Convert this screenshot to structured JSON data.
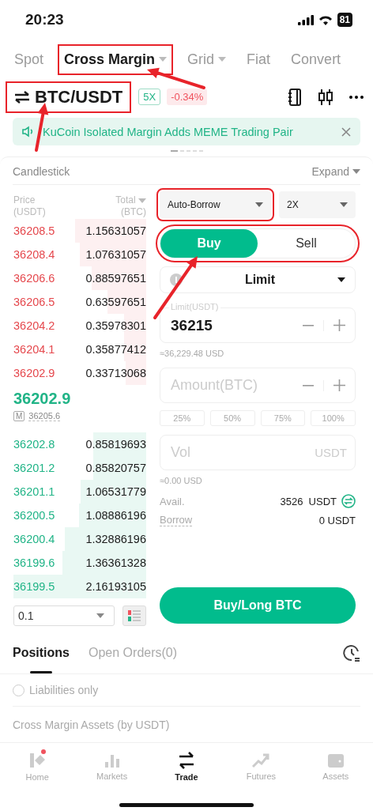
{
  "status_bar": {
    "time": "20:23",
    "battery": "81"
  },
  "market_tabs": [
    {
      "label": "Spot",
      "selected": false,
      "dropdown": false,
      "highlighted": false
    },
    {
      "label": "Cross Margin",
      "selected": true,
      "dropdown": true,
      "highlighted": true
    },
    {
      "label": "Grid",
      "selected": false,
      "dropdown": true,
      "highlighted": false
    },
    {
      "label": "Fiat",
      "selected": false,
      "dropdown": false,
      "highlighted": false
    },
    {
      "label": "Convert",
      "selected": false,
      "dropdown": false,
      "highlighted": false
    }
  ],
  "annotations": {
    "tab_arrow": true,
    "pair_arrow": true,
    "sides_arrow": true
  },
  "pair": {
    "symbol": "BTC/USDT",
    "highlighted": true,
    "leverage": "5X",
    "change": "-0.34%"
  },
  "banner": {
    "text": "KuCoin Isolated Margin Adds MEME Trading Pair"
  },
  "chart_header": {
    "title": "Candlestick",
    "expand": "Expand"
  },
  "order_book": {
    "price_label": "Price",
    "price_unit": "(USDT)",
    "total_label": "Total",
    "total_unit": "(BTC)",
    "asks": [
      {
        "price": "36208.5",
        "total": "1.15631057"
      },
      {
        "price": "36208.4",
        "total": "1.07631057"
      },
      {
        "price": "36206.6",
        "total": "0.88597651"
      },
      {
        "price": "36206.5",
        "total": "0.63597651"
      },
      {
        "price": "36204.2",
        "total": "0.35978301"
      },
      {
        "price": "36204.1",
        "total": "0.35877412"
      },
      {
        "price": "36202.9",
        "total": "0.33713068"
      }
    ],
    "last_price": "36202.9",
    "mark_label": "M",
    "mark_price": "36205.6",
    "bids": [
      {
        "price": "36202.8",
        "total": "0.85819693"
      },
      {
        "price": "36201.2",
        "total": "0.85820757"
      },
      {
        "price": "36201.1",
        "total": "1.06531779"
      },
      {
        "price": "36200.5",
        "total": "1.08886196"
      },
      {
        "price": "36200.4",
        "total": "1.32886196"
      },
      {
        "price": "36199.6",
        "total": "1.36361328"
      },
      {
        "price": "36199.5",
        "total": "2.16193105"
      }
    ],
    "precision": "0.1"
  },
  "order_form": {
    "borrow_mode": {
      "value": "Auto-Borrow",
      "highlighted": true
    },
    "leverage": "2X",
    "sides": [
      {
        "label": "Buy",
        "selected": true
      },
      {
        "label": "Sell",
        "selected": false
      }
    ],
    "sides_highlighted": true,
    "order_type": "Limit",
    "price": {
      "label": "Limit(USDT)",
      "value": "36215"
    },
    "price_usd": "≈36,229.48 USD",
    "amount": {
      "placeholder": "Amount(BTC)"
    },
    "percents": [
      "25%",
      "50%",
      "75%",
      "100%"
    ],
    "volume": {
      "placeholder": "Vol",
      "unit": "USDT"
    },
    "volume_usd": "≈0.00 USD",
    "available": {
      "label": "Avail.",
      "value": "3526  USDT"
    },
    "borrow": {
      "label": "Borrow",
      "value": "0 USDT"
    },
    "submit": "Buy/Long BTC"
  },
  "positions_tabs": [
    {
      "label": "Positions",
      "selected": true
    },
    {
      "label": "Open Orders(0)",
      "selected": false
    }
  ],
  "liabilities_only": {
    "label": "Liabilities only",
    "checked": false
  },
  "assets_title": "Cross Margin Assets (by USDT)",
  "nav": [
    {
      "label": "Home",
      "selected": false,
      "badge": true
    },
    {
      "label": "Markets",
      "selected": false,
      "badge": false
    },
    {
      "label": "Trade",
      "selected": true,
      "badge": false
    },
    {
      "label": "Futures",
      "selected": false,
      "badge": false
    },
    {
      "label": "Assets",
      "selected": false,
      "badge": false
    }
  ]
}
